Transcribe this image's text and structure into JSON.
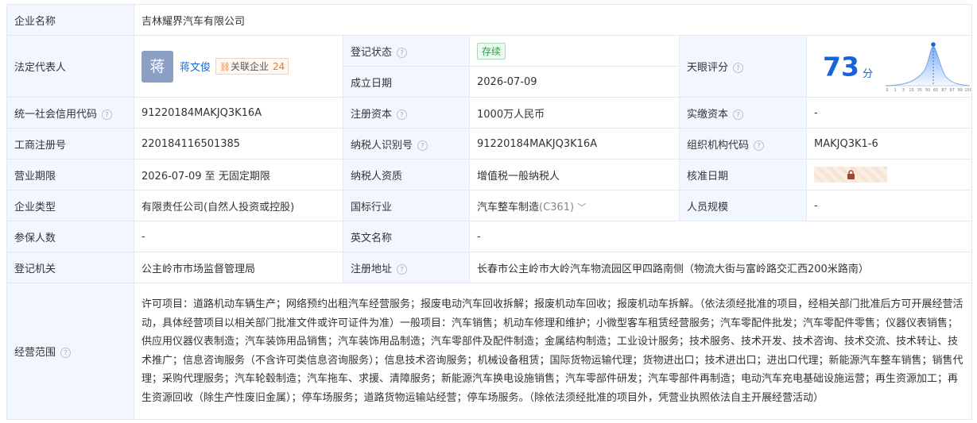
{
  "company": {
    "name_label": "企业名称",
    "name": "吉林耀界汽车有限公司"
  },
  "legal_rep": {
    "label": "法定代表人",
    "avatar_char": "蒋",
    "name": "蒋文俊",
    "assoc_label": "关联企业",
    "assoc_count": "24"
  },
  "reg_status": {
    "label": "登记状态",
    "value": "存续"
  },
  "founded": {
    "label": "成立日期",
    "value": "2026-07-09"
  },
  "tianyan": {
    "label": "天眼评分",
    "score": "73",
    "unit": "分",
    "axis_ticks": [
      "0",
      "1",
      "3",
      "15",
      "35",
      "50",
      "65",
      "87",
      "97",
      "99",
      "100"
    ]
  },
  "credit_code": {
    "label": "统一社会信用代码",
    "value": "91220184MAKJQ3K16A"
  },
  "reg_capital": {
    "label": "注册资本",
    "value": "1000万人民币"
  },
  "paid_capital": {
    "label": "实缴资本",
    "value": "-"
  },
  "biz_reg_no": {
    "label": "工商注册号",
    "value": "220184116501385"
  },
  "taxpayer_id": {
    "label": "纳税人识别号",
    "value": "91220184MAKJQ3K16A"
  },
  "org_code": {
    "label": "组织机构代码",
    "value": "MAKJQ3K1-6"
  },
  "biz_term": {
    "label": "营业期限",
    "value": "2026-07-09 至 无固定期限"
  },
  "taxpayer_qual": {
    "label": "纳税人资质",
    "value": "增值税一般纳税人"
  },
  "approve_date": {
    "label": "核准日期"
  },
  "company_type": {
    "label": "企业类型",
    "value": "有限责任公司(自然人投资或控股)"
  },
  "industry": {
    "label": "国标行业",
    "value": "汽车整车制造",
    "code": "(C361)"
  },
  "staff_size": {
    "label": "人员规模",
    "value": "-"
  },
  "insured": {
    "label": "参保人数",
    "value": "-"
  },
  "english_name": {
    "label": "英文名称",
    "value": "-"
  },
  "reg_authority": {
    "label": "登记机关",
    "value": "公主岭市市场监督管理局"
  },
  "reg_address": {
    "label": "注册地址",
    "value": "长春市公主岭市大岭汽车物流园区甲四路南侧（物流大街与富岭路交汇西200米路南）"
  },
  "scope": {
    "label": "经营范围",
    "text": "许可项目：道路机动车辆生产；网络预约出租汽车经营服务；报废电动汽车回收拆解；报废机动车回收；报废机动车拆解。（依法须经批准的项目，经相关部门批准后方可开展经营活动，具体经营项目以相关部门批准文件或许可证件为准）一般项目：汽车销售；机动车修理和维护；小微型客车租赁经营服务；汽车零配件批发；汽车零配件零售；仪器仪表销售；供应用仪器仪表制造；汽车装饰用品销售；汽车装饰用品制造；汽车零部件及配件制造；金属结构制造；工业设计服务；技术服务、技术开发、技术咨询、技术交流、技术转让、技术推广；信息咨询服务（不含许可类信息咨询服务）；信息技术咨询服务；机械设备租赁；国际货物运输代理；货物进出口；技术进出口；进出口代理；新能源汽车整车销售；销售代理；采购代理服务；汽车轮毂制造；汽车拖车、求援、清障服务；新能源汽车换电设施销售；汽车零部件研发；汽车零部件再制造；电动汽车充电基础设施运营；再生资源加工；再生资源回收（除生产性废旧金属）；停车场服务；道路货物运输站经营；停车场服务。（除依法须经批准的项目外，凭营业执照依法自主开展经营活动）"
  },
  "colors": {
    "label_bg": "#f2f7ff",
    "border": "#e4e8ef",
    "link": "#1a6ad6",
    "score": "#1763d8",
    "status_green": "#2a9d4b"
  }
}
